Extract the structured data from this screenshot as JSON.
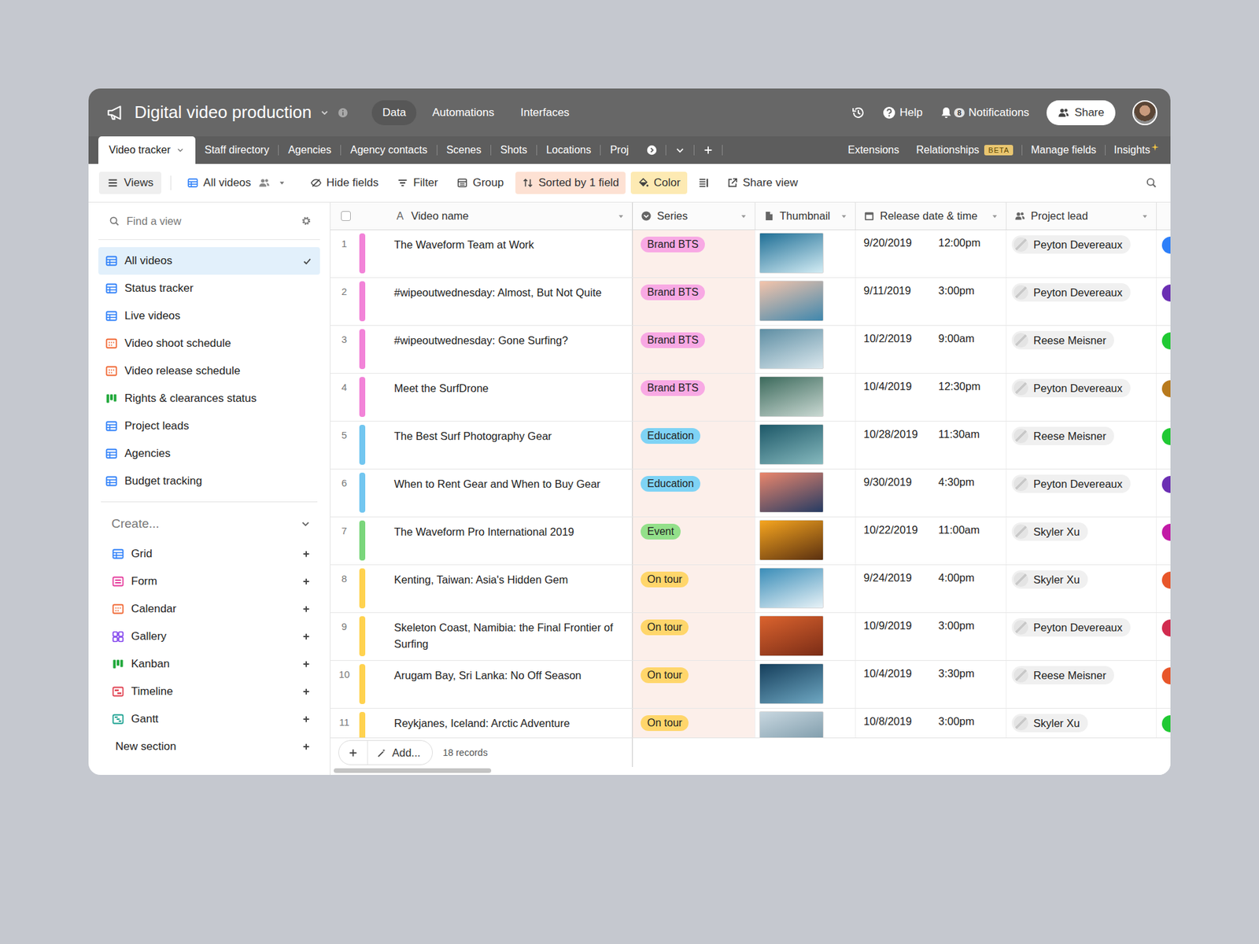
{
  "app": {
    "title": "Digital video production",
    "nav": [
      {
        "label": "Data",
        "selected": true
      },
      {
        "label": "Automations",
        "selected": false
      },
      {
        "label": "Interfaces",
        "selected": false
      }
    ],
    "help": "Help",
    "notifications": {
      "label": "Notifications",
      "count": "8"
    },
    "share": "Share"
  },
  "tables": [
    {
      "label": "Video tracker",
      "selected": true
    },
    {
      "label": "Staff directory",
      "selected": false
    },
    {
      "label": "Agencies",
      "selected": false
    },
    {
      "label": "Agency contacts",
      "selected": false
    },
    {
      "label": "Scenes",
      "selected": false
    },
    {
      "label": "Shots",
      "selected": false
    },
    {
      "label": "Locations",
      "selected": false
    },
    {
      "label": "Proj",
      "selected": false
    }
  ],
  "tableTools": {
    "extensions": "Extensions",
    "relationships": "Relationships",
    "badge": "BETA",
    "manageFields": "Manage fields",
    "insights": "Insights"
  },
  "toolbar": {
    "views": "Views",
    "currentView": "All videos",
    "buttons": [
      {
        "label": "Hide fields",
        "kind": "hide",
        "active": false,
        "color": "#ffffff"
      },
      {
        "label": "Filter",
        "kind": "filter",
        "active": false,
        "color": "#ffffff"
      },
      {
        "label": "Group",
        "kind": "group",
        "active": false,
        "color": "#ffffff"
      },
      {
        "label": "Sorted by 1 field",
        "kind": "sort",
        "active": true,
        "color": "#fde1d3"
      },
      {
        "label": "Color",
        "kind": "color",
        "active": true,
        "color": "#fdeab3"
      }
    ],
    "shareView": "Share view"
  },
  "sidebar": {
    "search": {
      "placeholder": "Find a view"
    },
    "views": [
      {
        "label": "All videos",
        "kind": "grid",
        "selected": true
      },
      {
        "label": "Status tracker",
        "kind": "grid",
        "selected": false
      },
      {
        "label": "Live videos",
        "kind": "grid",
        "selected": false
      },
      {
        "label": "Video shoot schedule",
        "kind": "calendar",
        "selected": false
      },
      {
        "label": "Video release schedule",
        "kind": "calendar",
        "selected": false
      },
      {
        "label": "Rights & clearances status",
        "kind": "kanban",
        "selected": false
      },
      {
        "label": "Project leads",
        "kind": "grid",
        "selected": false
      },
      {
        "label": "Agencies",
        "kind": "grid",
        "selected": false
      },
      {
        "label": "Budget tracking",
        "kind": "grid",
        "selected": false
      }
    ],
    "create": {
      "title": "Create...",
      "items": [
        {
          "label": "Grid",
          "kind": "grid"
        },
        {
          "label": "Form",
          "kind": "form"
        },
        {
          "label": "Calendar",
          "kind": "calendar"
        },
        {
          "label": "Gallery",
          "kind": "gallery"
        },
        {
          "label": "Kanban",
          "kind": "kanban"
        },
        {
          "label": "Timeline",
          "kind": "timeline"
        },
        {
          "label": "Gantt",
          "kind": "gantt"
        }
      ],
      "newSection": "New section"
    }
  },
  "table": {
    "columns": [
      {
        "label": "Video name",
        "kind": "text",
        "icon": "A",
        "sorted": false
      },
      {
        "label": "Series",
        "kind": "select",
        "sorted": true
      },
      {
        "label": "Thumbnail",
        "kind": "attachment",
        "sorted": false
      },
      {
        "label": "Release date & time",
        "kind": "date",
        "sorted": false
      },
      {
        "label": "Project lead",
        "kind": "user",
        "sorted": false
      }
    ],
    "rows": [
      {
        "number": "1",
        "name": "The Waveform Team at Work",
        "color": "#f283d8",
        "series": {
          "label": "Brand BTS",
          "color": "#f8a9e4"
        },
        "thumb": [
          "#1f6f96",
          "#d3ecf4"
        ],
        "date": "9/20/2019",
        "time": "12:00pm",
        "lead": "Peyton Devereaux",
        "tag": "#2d7ff9"
      },
      {
        "number": "2",
        "name": "#wipeoutwednesday: Almost, But Not Quite",
        "color": "#f283d8",
        "series": {
          "label": "Brand BTS",
          "color": "#f8a9e4"
        },
        "thumb": [
          "#f4c4ab",
          "#3f87ad"
        ],
        "date": "9/11/2019",
        "time": "3:00pm",
        "lead": "Peyton Devereaux",
        "tag": "#6b2fb3"
      },
      {
        "number": "3",
        "name": "#wipeoutwednesday: Gone Surfing?",
        "color": "#f283d8",
        "series": {
          "label": "Brand BTS",
          "color": "#f8a9e4"
        },
        "thumb": [
          "#5e8ea3",
          "#dbe8ee"
        ],
        "date": "10/2/2019",
        "time": "9:00am",
        "lead": "Reese Meisner",
        "tag": "#20c933"
      },
      {
        "number": "4",
        "name": "Meet the SurfDrone",
        "color": "#f283d8",
        "series": {
          "label": "Brand BTS",
          "color": "#f8a9e4"
        },
        "thumb": [
          "#3c6a5c",
          "#cad9d3"
        ],
        "date": "10/4/2019",
        "time": "12:30pm",
        "lead": "Peyton Devereaux",
        "tag": "#b87a1d"
      },
      {
        "number": "5",
        "name": "The Best Surf Photography Gear",
        "color": "#72c6f0",
        "series": {
          "label": "Education",
          "color": "#7fd3f5"
        },
        "thumb": [
          "#1d5868",
          "#86b9be"
        ],
        "date": "10/28/2019",
        "time": "11:30am",
        "lead": "Reese Meisner",
        "tag": "#20c933"
      },
      {
        "number": "6",
        "name": "When to Rent Gear and When to Buy Gear",
        "color": "#72c6f0",
        "series": {
          "label": "Education",
          "color": "#7fd3f5"
        },
        "thumb": [
          "#ea866c",
          "#253b63"
        ],
        "date": "9/30/2019",
        "time": "4:30pm",
        "lead": "Peyton Devereaux",
        "tag": "#6b2fb3"
      },
      {
        "number": "7",
        "name": "The Waveform Pro International 2019",
        "color": "#7ad67b",
        "series": {
          "label": "Event",
          "color": "#93e08a"
        },
        "thumb": [
          "#f6a51f",
          "#5a3010"
        ],
        "date": "10/22/2019",
        "time": "11:00am",
        "lead": "Skyler Xu",
        "tag": "#c21aa6"
      },
      {
        "number": "8",
        "name": "Kenting, Taiwan: Asia's Hidden Gem",
        "color": "#ffd24f",
        "series": {
          "label": "On tour",
          "color": "#ffd66b"
        },
        "thumb": [
          "#3a8db8",
          "#e7f2f7"
        ],
        "date": "9/24/2019",
        "time": "4:00pm",
        "lead": "Skyler Xu",
        "tag": "#e8562a"
      },
      {
        "number": "9",
        "name": "Skeleton Coast, Namibia: the Final Frontier of Surfing",
        "color": "#ffd24f",
        "series": {
          "label": "On tour",
          "color": "#ffd66b"
        },
        "thumb": [
          "#db632e",
          "#7a2c16"
        ],
        "date": "10/9/2019",
        "time": "3:00pm",
        "lead": "Peyton Devereaux",
        "tag": "#d12b4f"
      },
      {
        "number": "10",
        "name": "Arugam Bay, Sri Lanka: No Off Season",
        "color": "#ffd24f",
        "series": {
          "label": "On tour",
          "color": "#ffd66b"
        },
        "thumb": [
          "#153e5b",
          "#6fa8c3"
        ],
        "date": "10/4/2019",
        "time": "3:30pm",
        "lead": "Reese Meisner",
        "tag": "#e8562a"
      },
      {
        "number": "11",
        "name": "Reykjanes, Iceland: Arctic Adventure",
        "color": "#ffd24f",
        "series": {
          "label": "On tour",
          "color": "#ffd66b"
        },
        "thumb": [
          "#c8d7e0",
          "#6f8f9f"
        ],
        "date": "10/8/2019",
        "time": "3:00pm",
        "lead": "Skyler Xu",
        "tag": "#20c933"
      }
    ],
    "footer": {
      "add": "Add...",
      "count": "18 records"
    }
  }
}
